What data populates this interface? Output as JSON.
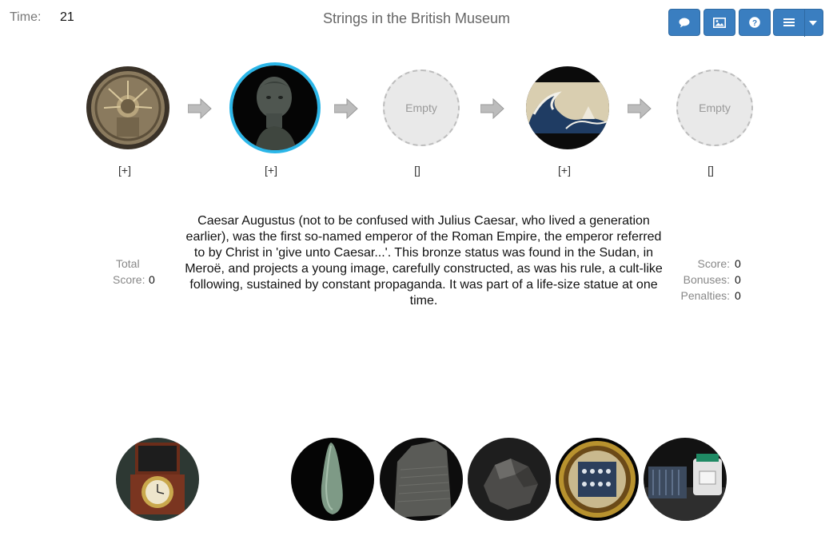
{
  "header": {
    "time_label": "Time:",
    "time_value": "21",
    "title": "Strings in the British Museum",
    "buttons": [
      {
        "name": "comment-button",
        "icon": "comment-icon"
      },
      {
        "name": "image-button",
        "icon": "image-icon"
      },
      {
        "name": "help-button",
        "icon": "question-icon"
      },
      {
        "name": "menu-button",
        "icon": "hamburger-icon"
      }
    ],
    "accent_color": "#3a7ec0"
  },
  "chain": {
    "slots": [
      {
        "state": "filled",
        "label": "[+]",
        "icon": "mosaic-helios-icon"
      },
      {
        "state": "selected",
        "label": "[+]",
        "icon": "augustus-bust-icon"
      },
      {
        "state": "empty",
        "text": "Empty",
        "label": "[]"
      },
      {
        "state": "filled",
        "label": "[+]",
        "icon": "great-wave-icon"
      },
      {
        "state": "empty",
        "text": "Empty",
        "label": "[]"
      }
    ],
    "selected_border_color": "#2bb6e8"
  },
  "description": "Caesar Augustus (not to be confused with Julius Caesar, who lived a generation earlier), was the first so-named emperor of the Roman Empire, the emperor referred to by Christ in 'give unto Caesar...'. This bronze status was found in the Sudan, in Meroë, and projects a young image, carefully constructed, as was his rule, a cult-like following, sustained by constant propaganda. It was part of a life-size statue at one time.",
  "total": {
    "label_line1": "Total",
    "label_line2": "Score:",
    "value": "0"
  },
  "scores": {
    "score_label": "Score:",
    "score_value": "0",
    "bonuses_label": "Bonuses:",
    "bonuses_value": "0",
    "penalties_label": "Penalties:",
    "penalties_value": "0"
  },
  "pool": [
    {
      "icon": "chronometer-icon"
    },
    {
      "icon": "stone-axe-icon"
    },
    {
      "icon": "rosetta-stone-icon"
    },
    {
      "icon": "meteorite-icon"
    },
    {
      "icon": "ornate-plate-icon"
    },
    {
      "icon": "solar-lamp-icon"
    }
  ]
}
